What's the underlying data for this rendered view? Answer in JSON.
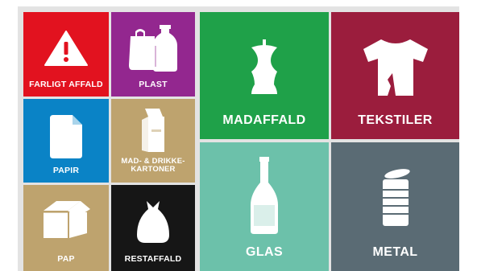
{
  "categories": {
    "farligt_affald": {
      "label": "FARLIGT AFFALD",
      "color": "#e2121f",
      "icon": "warning-triangle-icon"
    },
    "plast": {
      "label": "PLAST",
      "color": "#93278f",
      "icon": "plastic-bottle-bag-icon"
    },
    "mad_drikkekartoner": {
      "label": "MAD- & DRIKKE-\nKARTONER",
      "color": "#bea36e",
      "icon": "milk-carton-icon"
    },
    "papir": {
      "label": "PAPIR",
      "color": "#0a83c6",
      "icon": "paper-sheet-icon"
    },
    "pap": {
      "label": "PAP",
      "color": "#bea36e",
      "icon": "cardboard-box-icon"
    },
    "restaffald": {
      "label": "RESTAFFALD",
      "color": "#161616",
      "icon": "garbage-bag-icon"
    },
    "madaffald": {
      "label": "MADAFFALD",
      "color": "#1fa149",
      "icon": "apple-core-icon"
    },
    "tekstiler": {
      "label": "TEKSTILER",
      "color": "#9b1d3d",
      "icon": "tshirt-icon"
    },
    "glas": {
      "label": "GLAS",
      "color": "#6cc1aa",
      "icon": "glass-bottle-icon"
    },
    "metal": {
      "label": "METAL",
      "color": "#5a6b74",
      "icon": "tin-can-icon"
    }
  }
}
